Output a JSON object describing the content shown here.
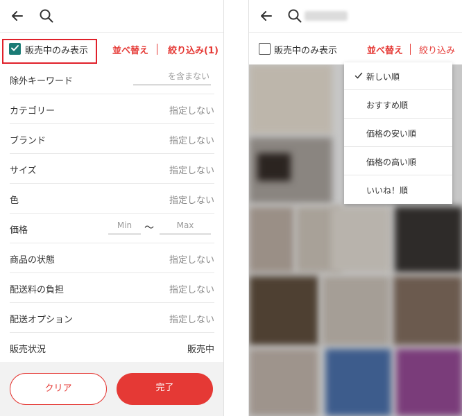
{
  "left_screen": {
    "filter_bar": {
      "on_sale_only_label": "販売中のみ表示",
      "sort_label": "並べ替え",
      "narrow_label": "絞り込み(1)"
    },
    "rows": [
      {
        "label": "除外キーワード",
        "placeholder": "を含まない"
      },
      {
        "label": "カテゴリー",
        "value": "指定しない"
      },
      {
        "label": "ブランド",
        "value": "指定しない"
      },
      {
        "label": "サイズ",
        "value": "指定しない"
      },
      {
        "label": "色",
        "value": "指定しない"
      },
      {
        "label": "価格",
        "min_placeholder": "Min",
        "separator": "〜",
        "max_placeholder": "Max"
      },
      {
        "label": "商品の状態",
        "value": "指定しない"
      },
      {
        "label": "配送料の負担",
        "value": "指定しない"
      },
      {
        "label": "配送オプション",
        "value": "指定しない"
      },
      {
        "label": "販売状況",
        "value": "販売中"
      }
    ],
    "buttons": {
      "clear": "クリア",
      "done": "完了"
    }
  },
  "right_screen": {
    "filter_bar": {
      "on_sale_only_label": "販売中のみ表示",
      "sort_label": "並べ替え",
      "narrow_label": "絞り込み"
    },
    "sort_menu": [
      {
        "label": "新しい順",
        "selected": true
      },
      {
        "label": "おすすめ順",
        "selected": false
      },
      {
        "label": "価格の安い順",
        "selected": false
      },
      {
        "label": "価格の高い順",
        "selected": false
      },
      {
        "label": "いいね！順",
        "selected": false
      }
    ]
  },
  "colors": {
    "accent": "#e53935",
    "checkbox": "#1a7b75",
    "highlight": "#e0202a"
  },
  "icons": [
    "back-arrow-icon",
    "search-icon",
    "checkmark-icon"
  ]
}
